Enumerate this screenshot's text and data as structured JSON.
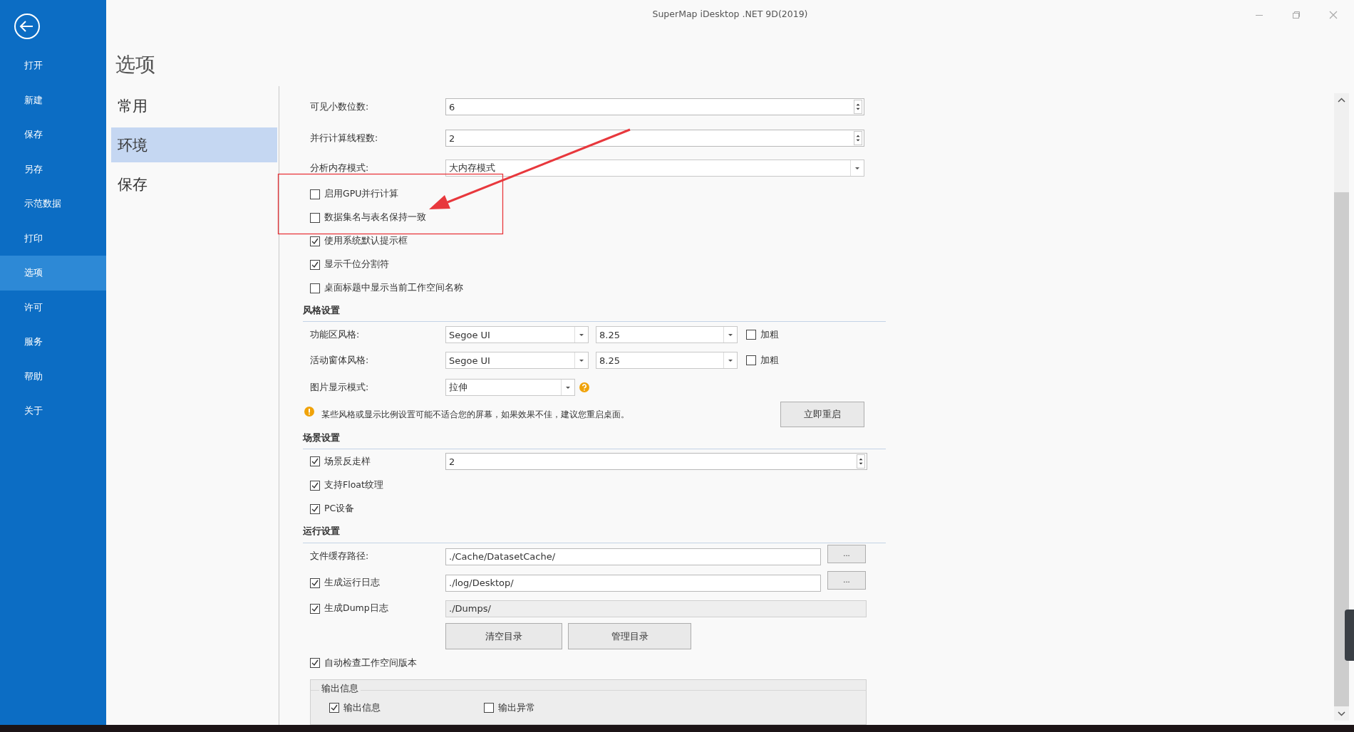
{
  "window": {
    "title": "SuperMap iDesktop .NET 9D(2019)"
  },
  "backstage_menu": [
    {
      "label": "打开",
      "selected": false
    },
    {
      "label": "新建",
      "selected": false
    },
    {
      "label": "保存",
      "selected": false
    },
    {
      "label": "另存",
      "selected": false
    },
    {
      "label": "示范数据",
      "selected": false
    },
    {
      "label": "打印",
      "selected": false
    },
    {
      "label": "选项",
      "selected": true
    },
    {
      "label": "许可",
      "selected": false
    },
    {
      "label": "服务",
      "selected": false
    },
    {
      "label": "帮助",
      "selected": false
    },
    {
      "label": "关于",
      "selected": false
    }
  ],
  "page_title": "选项",
  "categories": [
    {
      "label": "常用",
      "selected": false
    },
    {
      "label": "环境",
      "selected": true
    },
    {
      "label": "保存",
      "selected": false
    }
  ],
  "environment": {
    "rows": [
      {
        "kind": "spin",
        "label": "可见小数位数:",
        "value": "6"
      },
      {
        "kind": "spin",
        "label": "并行计算线程数:",
        "value": "2"
      },
      {
        "kind": "dropdown",
        "label": "分析内存模式:",
        "value": "大内存模式"
      },
      {
        "kind": "checkbox",
        "label": "启用GPU并行计算",
        "checked": false
      },
      {
        "kind": "checkbox",
        "label": "数据集名与表名保持一致",
        "checked": false
      },
      {
        "kind": "checkbox",
        "label": "使用系统默认提示框",
        "checked": true
      },
      {
        "kind": "checkbox",
        "label": "显示千位分割符",
        "checked": true
      },
      {
        "kind": "checkbox",
        "label": "桌面标题中显示当前工作空间名称",
        "checked": false
      },
      {
        "kind": "section",
        "title": "风格设置"
      },
      {
        "kind": "font",
        "label": "功能区风格:",
        "font": "Segoe UI",
        "size": "8.25",
        "bold_label": "加粗",
        "bold": false
      },
      {
        "kind": "font",
        "label": "活动窗体风格:",
        "font": "Segoe UI",
        "size": "8.25",
        "bold_label": "加粗",
        "bold": false
      },
      {
        "kind": "dropdown_help",
        "label": "图片显示模式:",
        "value": "拉伸"
      },
      {
        "kind": "notice",
        "text": "某些风格或显示比例设置可能不适合您的屏幕，如果效果不佳，建议您重启桌面。",
        "button": "立即重启"
      },
      {
        "kind": "section",
        "title": "场景设置"
      },
      {
        "kind": "check_spin",
        "label": "场景反走样",
        "checked": true,
        "value": "2"
      },
      {
        "kind": "checkbox",
        "label": "支持Float纹理",
        "checked": true
      },
      {
        "kind": "checkbox",
        "label": "PC设备",
        "checked": true
      },
      {
        "kind": "section",
        "title": "运行设置"
      },
      {
        "kind": "path",
        "label": "文件缓存路径:",
        "value": "./Cache/DatasetCache/",
        "button": "...",
        "disabled": false
      },
      {
        "kind": "check_path",
        "label": "生成运行日志",
        "checked": true,
        "value": "./log/Desktop/",
        "button": "...",
        "disabled": false
      },
      {
        "kind": "check_path",
        "label": "生成Dump日志",
        "checked": true,
        "value": "./Dumps/",
        "disabled": true
      },
      {
        "kind": "buttons",
        "buttons": [
          "清空目录",
          "管理目录"
        ]
      },
      {
        "kind": "checkbox",
        "label": "自动检查工作空间版本",
        "checked": true
      },
      {
        "kind": "group",
        "title": "输出信息",
        "items": [
          {
            "label": "输出信息",
            "checked": true
          },
          {
            "label": "输出异常",
            "checked": false
          }
        ]
      }
    ]
  }
}
